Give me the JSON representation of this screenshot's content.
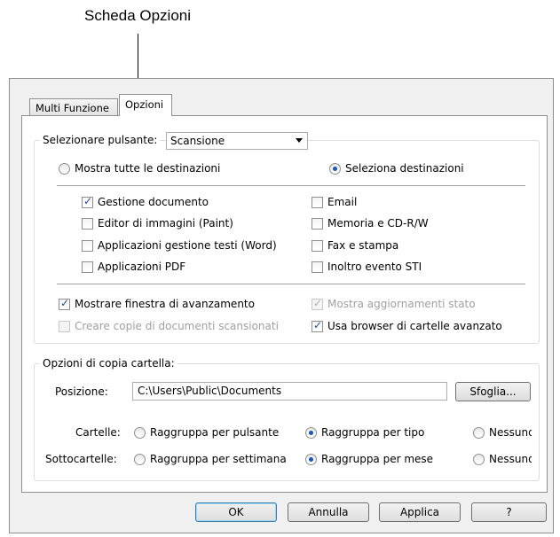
{
  "callout": {
    "text": "Scheda Opzioni"
  },
  "tabs": {
    "multi": "Multi Funzione",
    "options": "Opzioni"
  },
  "select_button": {
    "label": "Selezionare pulsante:",
    "value": "Scansione"
  },
  "destinations": {
    "show_all": "Mostra tutte le destinazioni",
    "select": "Seleziona destinazioni",
    "left": [
      "Gestione documento",
      "Editor di immagini (Paint)",
      "Applicazioni gestione testi (Word)",
      "Applicazioni  PDF"
    ],
    "right": [
      "Email",
      "Memoria e CD-R/W",
      "Fax e stampa",
      "Inoltro evento STI"
    ]
  },
  "options": {
    "progress": "Mostrare finestra di avanzamento",
    "status": "Mostra aggiornamenti stato",
    "copies": "Creare copie di documenti scansionati",
    "browser": "Usa browser di cartelle avanzato"
  },
  "folder_copy": {
    "legend": "Opzioni di copia cartella:",
    "position_label": "Posizione:",
    "position_value": "C:\\Users\\Public\\Documents",
    "browse": "Sfoglia...",
    "folders_label": "Cartelle:",
    "folders": [
      "Raggruppa per pulsante",
      "Raggruppa per tipo",
      "Nessuno"
    ],
    "subfolders_label": "Sottocartelle:",
    "subfolders": [
      "Raggruppa per settimana",
      "Raggruppa per mese",
      "Nessuno"
    ]
  },
  "buttons": {
    "ok": "OK",
    "cancel": "Annulla",
    "apply": "Applica",
    "help": "?"
  }
}
